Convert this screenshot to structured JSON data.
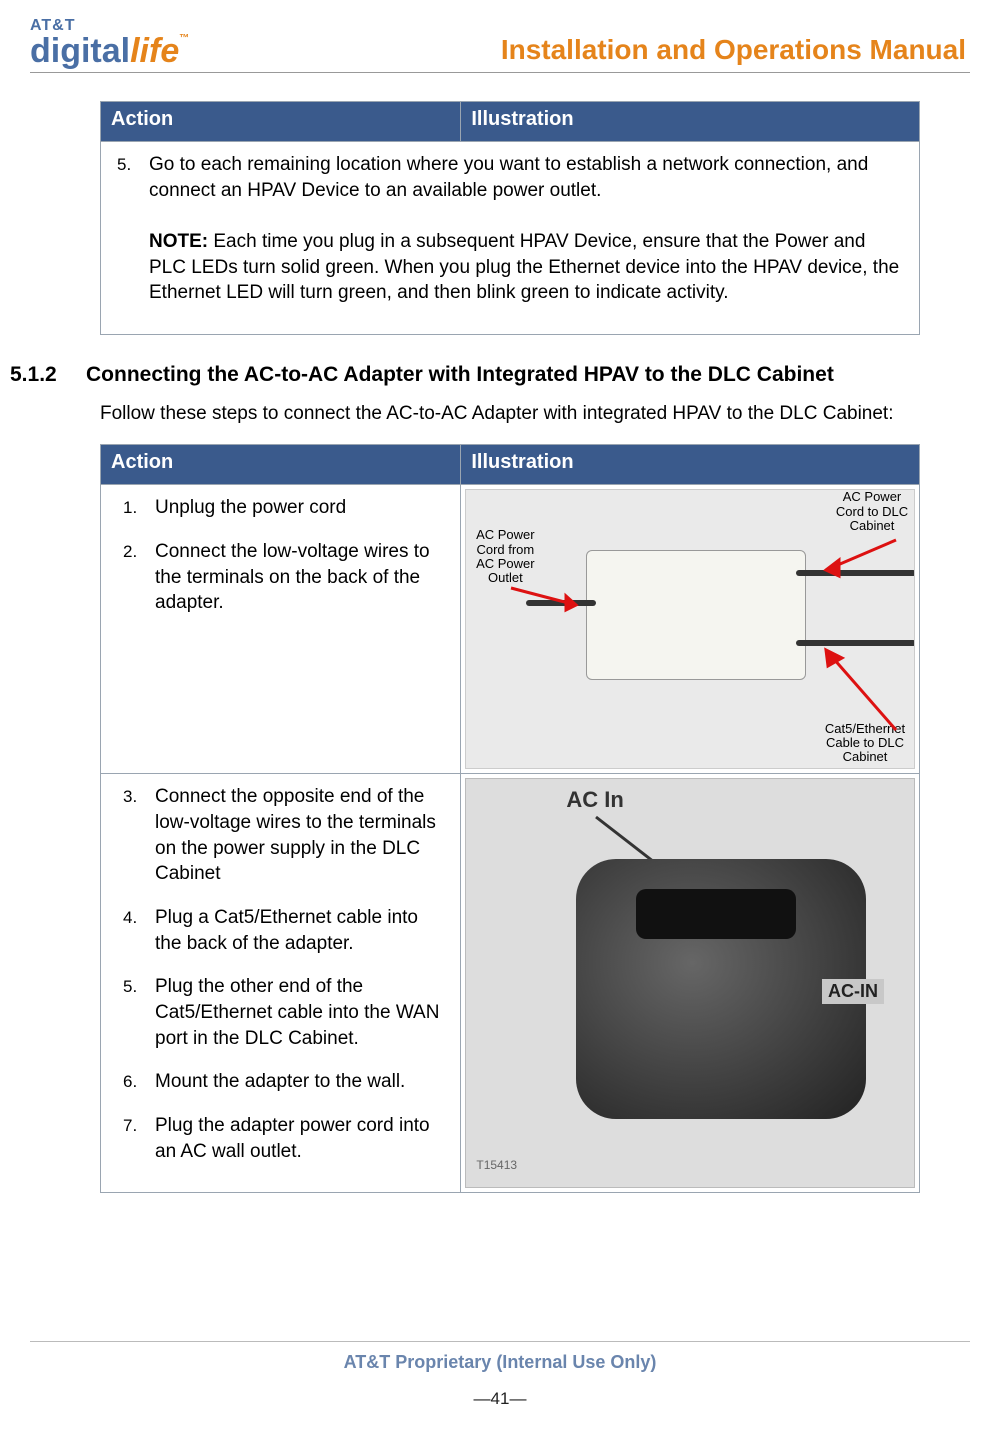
{
  "header": {
    "logo_line1": "AT&T",
    "logo_line2a": "digital",
    "logo_line2b": "life",
    "logo_tm": "™",
    "doc_title": "Installation and Operations Manual"
  },
  "table1": {
    "col_action": "Action",
    "col_illustration": "Illustration",
    "step5_num": "5.",
    "step5_text": "Go to each remaining location where you want to establish a network connection, and connect an HPAV Device to an available power outlet.",
    "note_label": "NOTE:",
    "note_text": " Each time you plug in a subsequent HPAV Device, ensure that the Power and PLC LEDs turn solid green.  When you plug the Ethernet device into the HPAV device, the Ethernet LED will turn green, and then blink green to indicate activity."
  },
  "section": {
    "number": "5.1.2",
    "title": "Connecting the AC-to-AC Adapter with Integrated HPAV to the DLC Cabinet",
    "intro": "Follow these steps to connect the AC-to-AC Adapter with integrated HPAV to the DLC Cabinet:"
  },
  "table2": {
    "col_action": "Action",
    "col_illustration": "Illustration",
    "row1": {
      "step1_num": "1.",
      "step1_text": "Unplug the power cord",
      "step2_num": "2.",
      "step2_text": "Connect the low-voltage wires to the terminals on the back of the adapter.",
      "img_label1": "AC Power Cord from AC Power Outlet",
      "img_label2": "AC Power Cord to DLC Cabinet",
      "img_label3": "Cat5/Ethernet Cable to DLC Cabinet"
    },
    "row2": {
      "step3_num": "3.",
      "step3_text": "Connect the opposite end of the low-voltage wires to the terminals on the power supply in the DLC Cabinet",
      "step4_num": "4.",
      "step4_text": "Plug a Cat5/Ethernet cable into the back of the adapter.",
      "step5_num": "5.",
      "step5_text": "Plug the other end of the Cat5/Ethernet cable into the WAN port in the DLC Cabinet.",
      "step6_num": "6.",
      "step6_text": "Mount the adapter to the wall.",
      "step7_num": "7.",
      "step7_text": "Plug the adapter power cord into an AC wall outlet.",
      "img_ac_in": "AC In",
      "img_ac_in_tag": "AC-IN",
      "img_id": "T15413"
    }
  },
  "footer": {
    "proprietary": "AT&T Proprietary (Internal Use Only)",
    "page": "—41—"
  }
}
